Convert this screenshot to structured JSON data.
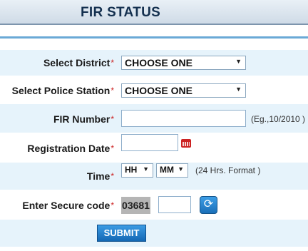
{
  "header": {
    "title": "FIR STATUS"
  },
  "form": {
    "district": {
      "label": "Select District",
      "required_mark": "*",
      "value": "CHOOSE ONE"
    },
    "police_station": {
      "label": "Select Police Station",
      "required_mark": "*",
      "value": "CHOOSE ONE"
    },
    "fir_number": {
      "label": "FIR Number",
      "required_mark": "*",
      "value": "",
      "hint": "(Eg.,10/2010 )"
    },
    "registration_date": {
      "label": "Registration Date",
      "required_mark": "*",
      "value": ""
    },
    "time": {
      "label": "Time",
      "required_mark": "*",
      "hour": "HH",
      "minute": "MM",
      "hint": "(24 Hrs. Format )"
    },
    "secure_code": {
      "label": "Enter Secure code",
      "required_mark": "*",
      "captcha": "03681",
      "value": ""
    },
    "submit_label": "SUBMIT"
  },
  "colors": {
    "accent": "#1a6fb8",
    "header_title": "#14304f",
    "row_light": "#e6f3fb",
    "required": "#cc2222"
  },
  "icons": {
    "select_arrow": "chevron-down-icon",
    "calendar": "calendar-icon",
    "refresh": "refresh-icon"
  }
}
